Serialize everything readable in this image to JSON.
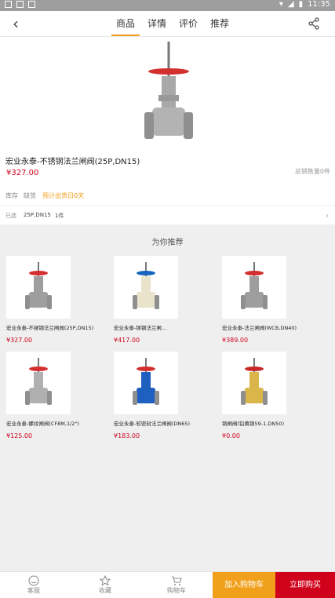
{
  "status_bar": {
    "time": "11:35"
  },
  "header": {
    "tabs": [
      {
        "label": "商品",
        "active": true
      },
      {
        "label": "详情",
        "active": false
      },
      {
        "label": "评价",
        "active": false
      },
      {
        "label": "推荐",
        "active": false
      }
    ]
  },
  "product": {
    "title": "宏业永泰-不锈钢法兰闸阀(25P,DN15)",
    "price": "¥327.00",
    "sales": "总销售量0件",
    "stock_label": "库存",
    "stock_value": "缺货",
    "ship_note": "预计出货日0天",
    "selected_label": "已选",
    "selected_spec": "25P,DN15",
    "selected_qty": "1件"
  },
  "recommend": {
    "title": "为你推荐",
    "items": [
      {
        "name": "宏业永泰-不锈钢法兰闸阀(25P,DN15)",
        "price": "¥327.00",
        "wheel": "#d32f2f",
        "body": "#9e9e9e"
      },
      {
        "name": "宏业永泰-铸钢法兰闸...",
        "price": "¥417.00",
        "wheel": "#1565c0",
        "body": "#e9e3cc"
      },
      {
        "name": "宏业永泰-法兰闸阀(WCB,DN40)",
        "price": "¥389.00",
        "wheel": "#d32f2f",
        "body": "#9e9e9e"
      },
      {
        "name": "宏业永泰-螺纹闸阀(CF8M,1/2\")",
        "price": "¥125.00",
        "wheel": "#d32f2f",
        "body": "#b0b0b0"
      },
      {
        "name": "宏业永泰-软密封法兰闸阀(DN65)",
        "price": "¥183.00",
        "wheel": "#d32f2f",
        "body": "#1e5fbf"
      },
      {
        "name": "铜闸阀(铅黄铜59-1,DN50)",
        "price": "¥0.00",
        "wheel": "#c62828",
        "body": "#d9b54a"
      }
    ]
  },
  "bottom_bar": {
    "service_label": "客服",
    "favorite_label": "收藏",
    "cart_label": "购物车",
    "add_to_cart": "加入购物车",
    "buy_now": "立即购买"
  },
  "colors": {
    "accent": "#f39c12",
    "price": "#d0021b",
    "add_cart_bg": "#f0a01a",
    "buy_bg": "#d0021b"
  }
}
